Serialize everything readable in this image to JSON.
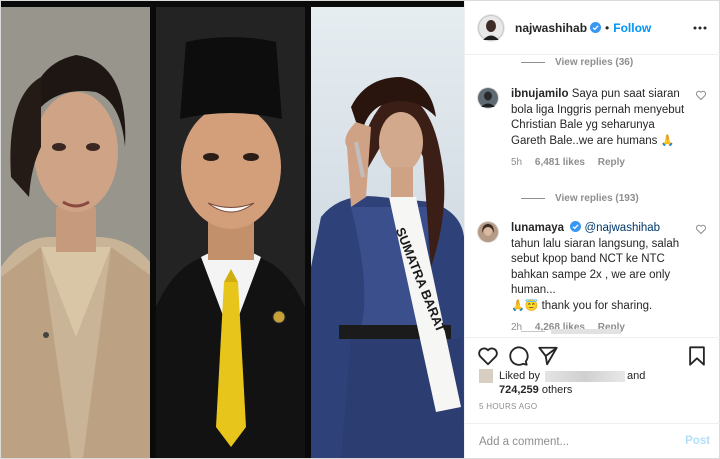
{
  "post": {
    "author": "najwashihab",
    "follow_label": "Follow",
    "separator": "•"
  },
  "media": {
    "sash_text": "SUMATRA BARAT"
  },
  "comments": {
    "view_replies_1": "View replies (36)",
    "view_replies_2": "View replies (193)",
    "items": [
      {
        "username": "ibnujamilo",
        "text": "Saya pun saat siaran bola liga Inggris pernah menyebut Christian Bale yg seharunya Gareth Bale..we are humans",
        "emoji": "🙏",
        "age": "5h",
        "likes": "6,481 likes",
        "reply": "Reply"
      },
      {
        "username": "lunamaya",
        "mention": "@najwashihab",
        "text": "tahun lalu siaran langsung, salah sebut kpop band NCT ke NTC bahkan sampe 2x , we are only human...",
        "emoji": "🙏😇",
        "text2": "thank you for sharing.",
        "age": "2h",
        "likes": "4,268 likes",
        "reply": "Reply"
      }
    ]
  },
  "likes": {
    "liked_by": "Liked by",
    "and": "and",
    "count": "724,259",
    "others": "others"
  },
  "timestamp": "5 HOURS AGO",
  "add_comment": {
    "placeholder": "Add a comment...",
    "post_label": "Post"
  },
  "colors": {
    "link": "#0095f6",
    "verified": "#3897f0",
    "muted": "#8e8e8e",
    "post_disabled": "#b2dffc"
  },
  "icons": [
    "verified-badge-icon",
    "more-options-icon",
    "heart-icon",
    "comment-icon",
    "share-icon",
    "bookmark-icon"
  ]
}
